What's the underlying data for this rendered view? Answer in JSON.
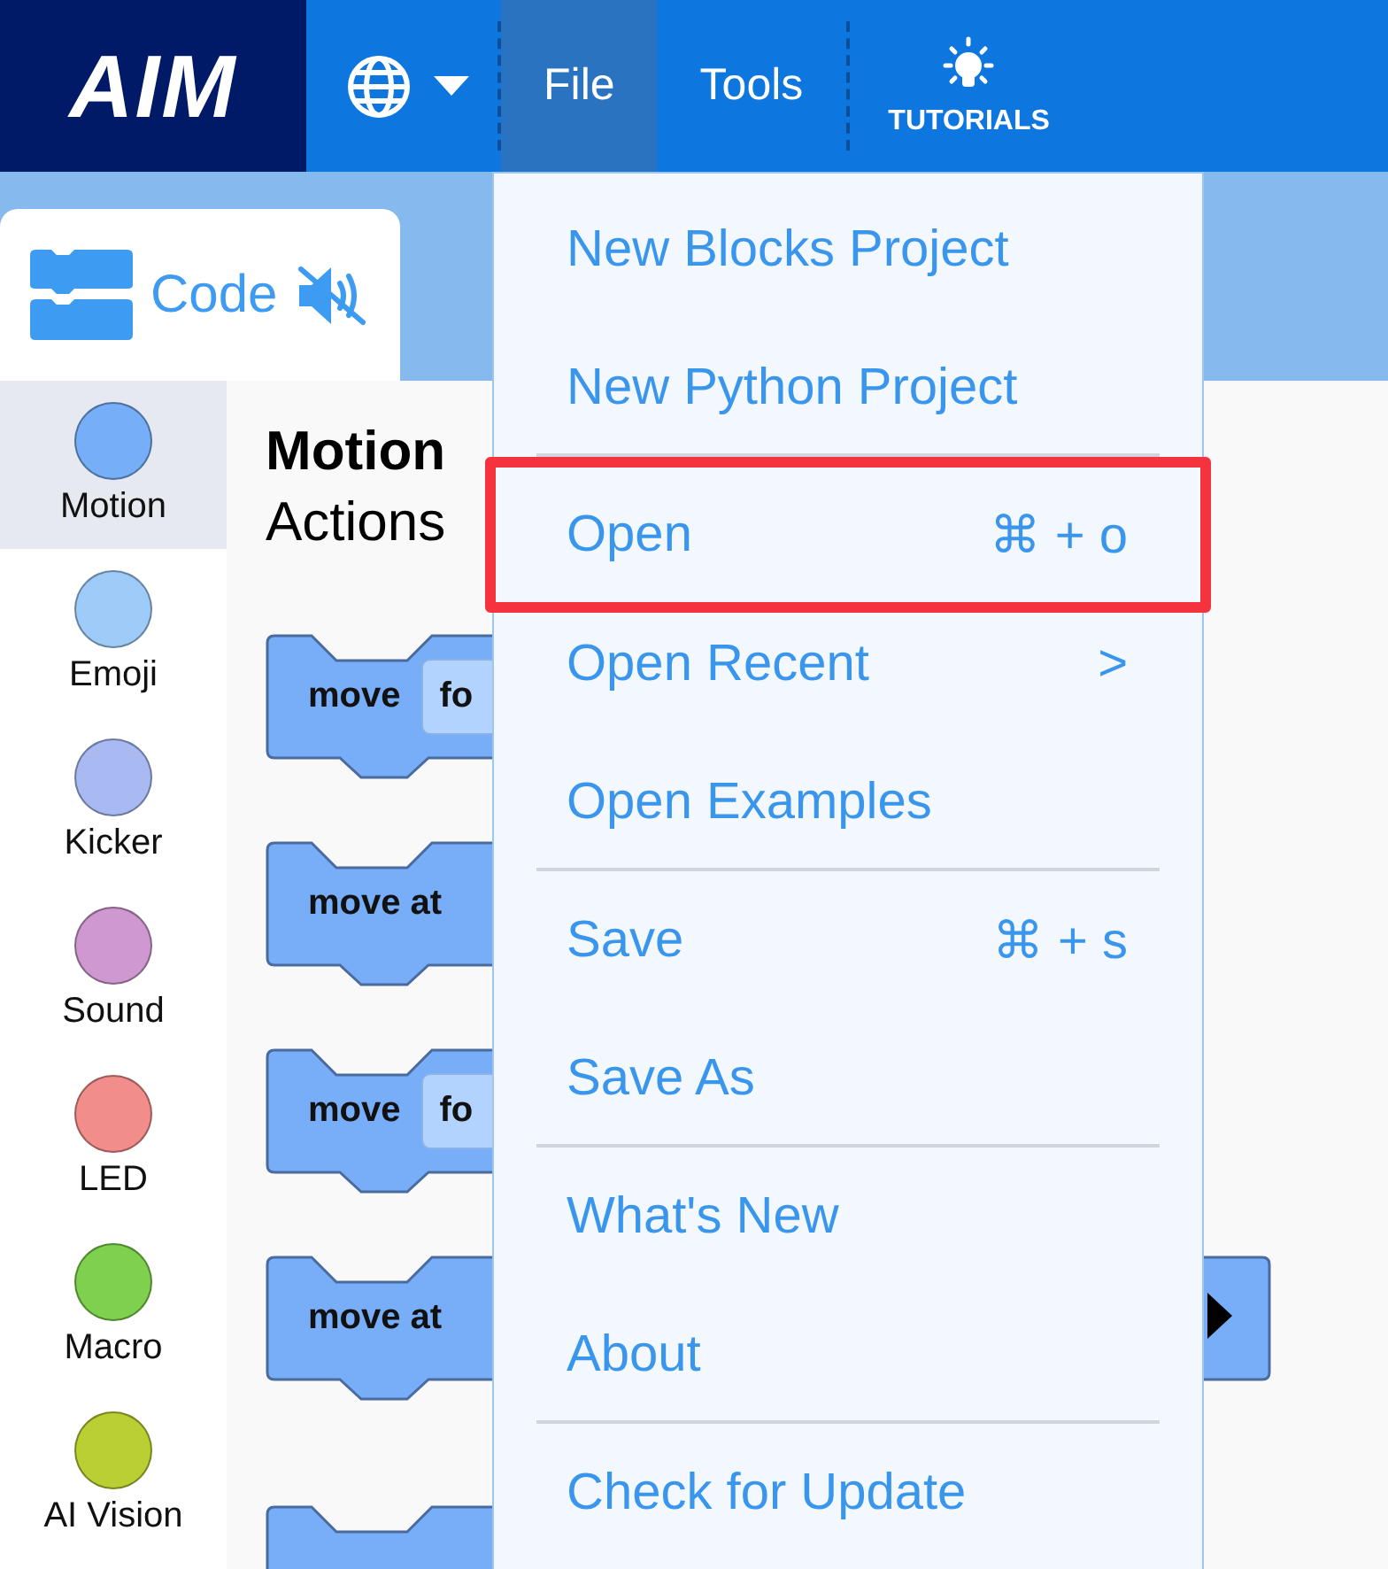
{
  "header": {
    "logo": "AIM",
    "nav": [
      {
        "label": "File",
        "selected": true
      },
      {
        "label": "Tools",
        "selected": false
      }
    ],
    "tutorials": "TUTORIALS"
  },
  "tab": {
    "label": "Code",
    "muted": true
  },
  "categories": [
    {
      "label": "Motion",
      "color": "#77aef8",
      "selected": true
    },
    {
      "label": "Emoji",
      "color": "#9fcbf8",
      "selected": false
    },
    {
      "label": "Kicker",
      "color": "#a9baf3",
      "selected": false
    },
    {
      "label": "Sound",
      "color": "#d098d0",
      "selected": false
    },
    {
      "label": "LED",
      "color": "#f18e8b",
      "selected": false
    },
    {
      "label": "Macro",
      "color": "#7ed04e",
      "selected": false
    },
    {
      "label": "AI Vision",
      "color": "#b9cf34",
      "selected": false
    }
  ],
  "palette": {
    "title": "Motion",
    "subtitle": "Actions",
    "blocks": [
      {
        "label": "move",
        "field": "fo",
        "expand": false
      },
      {
        "label": "move at",
        "expand": false
      },
      {
        "label": "move",
        "field": "fo",
        "expand": false
      },
      {
        "label": "move at",
        "expand": true
      },
      {
        "expand": false
      }
    ]
  },
  "file_menu": [
    {
      "label": "New Blocks Project",
      "divider_after": false,
      "highlighted": false
    },
    {
      "label": "New Python Project",
      "divider_after": true,
      "highlighted": false
    },
    {
      "label": "Open",
      "shortcut": "⌘ + o",
      "divider_after": false,
      "highlighted": true
    },
    {
      "label": "Open Recent",
      "shortcut": ">",
      "divider_after": false,
      "highlighted": false
    },
    {
      "label": "Open Examples",
      "divider_after": true,
      "highlighted": false
    },
    {
      "label": "Save",
      "shortcut": "⌘ + s",
      "divider_after": false,
      "highlighted": false
    },
    {
      "label": "Save As",
      "divider_after": true,
      "highlighted": false
    },
    {
      "label": "What's New",
      "divider_after": false,
      "highlighted": false
    },
    {
      "label": "About",
      "divider_after": true,
      "highlighted": false
    },
    {
      "label": "Check for Update",
      "divider_after": false,
      "highlighted": false
    }
  ]
}
